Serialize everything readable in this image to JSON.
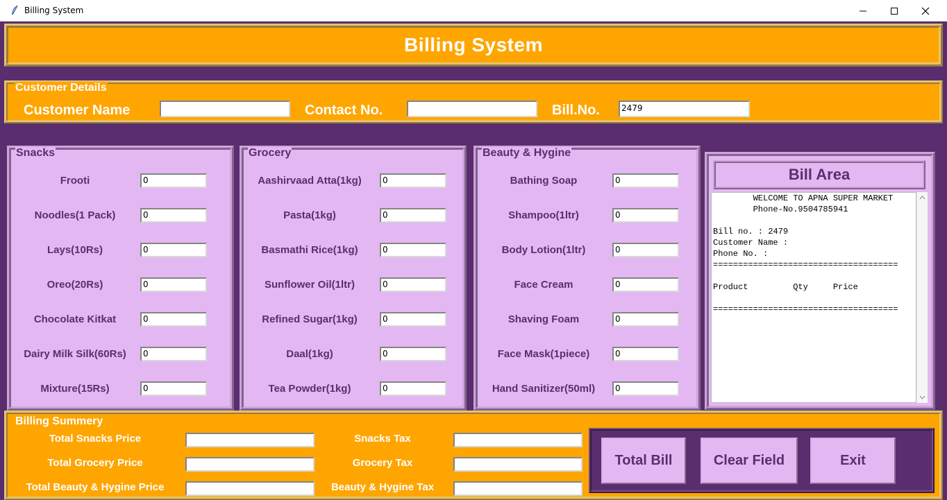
{
  "window": {
    "title": "Billing System",
    "controls": [
      "minimize-icon",
      "maximize-icon",
      "close-icon"
    ]
  },
  "header": {
    "title": "Billing System"
  },
  "customer": {
    "legend": "Customer Details",
    "name_label": "Customer Name",
    "name_value": "",
    "contact_label": "Contact No.",
    "contact_value": "",
    "bill_label": "Bill.No.",
    "bill_value": "2479"
  },
  "snacks": {
    "legend": "Snacks",
    "items": [
      {
        "label": "Frooti",
        "qty": "0"
      },
      {
        "label": "Noodles(1 Pack)",
        "qty": "0"
      },
      {
        "label": "Lays(10Rs)",
        "qty": "0"
      },
      {
        "label": "Oreo(20Rs)",
        "qty": "0"
      },
      {
        "label": "Chocolate Kitkat",
        "qty": "0"
      },
      {
        "label": "Dairy Milk Silk(60Rs)",
        "qty": "0"
      },
      {
        "label": "Mixture(15Rs)",
        "qty": "0"
      }
    ]
  },
  "grocery": {
    "legend": "Grocery",
    "items": [
      {
        "label": "Aashirvaad Atta(1kg)",
        "qty": "0"
      },
      {
        "label": "Pasta(1kg)",
        "qty": "0"
      },
      {
        "label": "Basmathi Rice(1kg)",
        "qty": "0"
      },
      {
        "label": "Sunflower Oil(1ltr)",
        "qty": "0"
      },
      {
        "label": "Refined Sugar(1kg)",
        "qty": "0"
      },
      {
        "label": "Daal(1kg)",
        "qty": "0"
      },
      {
        "label": "Tea Powder(1kg)",
        "qty": "0"
      }
    ]
  },
  "beauty": {
    "legend": "Beauty & Hygine",
    "items": [
      {
        "label": "Bathing Soap",
        "qty": "0"
      },
      {
        "label": "Shampoo(1ltr)",
        "qty": "0"
      },
      {
        "label": "Body Lotion(1ltr)",
        "qty": "0"
      },
      {
        "label": "Face Cream",
        "qty": "0"
      },
      {
        "label": "Shaving Foam",
        "qty": "0"
      },
      {
        "label": "Face Mask(1piece)",
        "qty": "0"
      },
      {
        "label": "Hand Sanitizer(50ml)",
        "qty": "0"
      }
    ]
  },
  "bill_area": {
    "title": "Bill Area",
    "lines": [
      "        WELCOME TO APNA SUPER MARKET",
      "        Phone-No.9504785941",
      "",
      "Bill no. : 2479",
      "Customer Name : ",
      "Phone No. : ",
      "=====================================",
      "",
      "Product         Qty     Price",
      "",
      "====================================="
    ]
  },
  "summary": {
    "legend": "Billing Summery",
    "total_snacks_label": "Total Snacks Price",
    "total_grocery_label": "Total Grocery Price",
    "total_beauty_label": "Total Beauty & Hygine Price",
    "snacks_tax_label": "Snacks Tax",
    "grocery_tax_label": "Grocery Tax",
    "beauty_tax_label": "Beauty & Hygine Tax",
    "total_snacks_value": "",
    "total_grocery_value": "",
    "total_beauty_value": "",
    "snacks_tax_value": "",
    "grocery_tax_value": "",
    "beauty_tax_value": ""
  },
  "buttons": {
    "total": "Total Bill",
    "clear": "Clear Field",
    "exit": "Exit"
  },
  "colors": {
    "accent_orange": "#ffa500",
    "purple": "#5a2d6e",
    "lavender": "#e3b8f2"
  }
}
